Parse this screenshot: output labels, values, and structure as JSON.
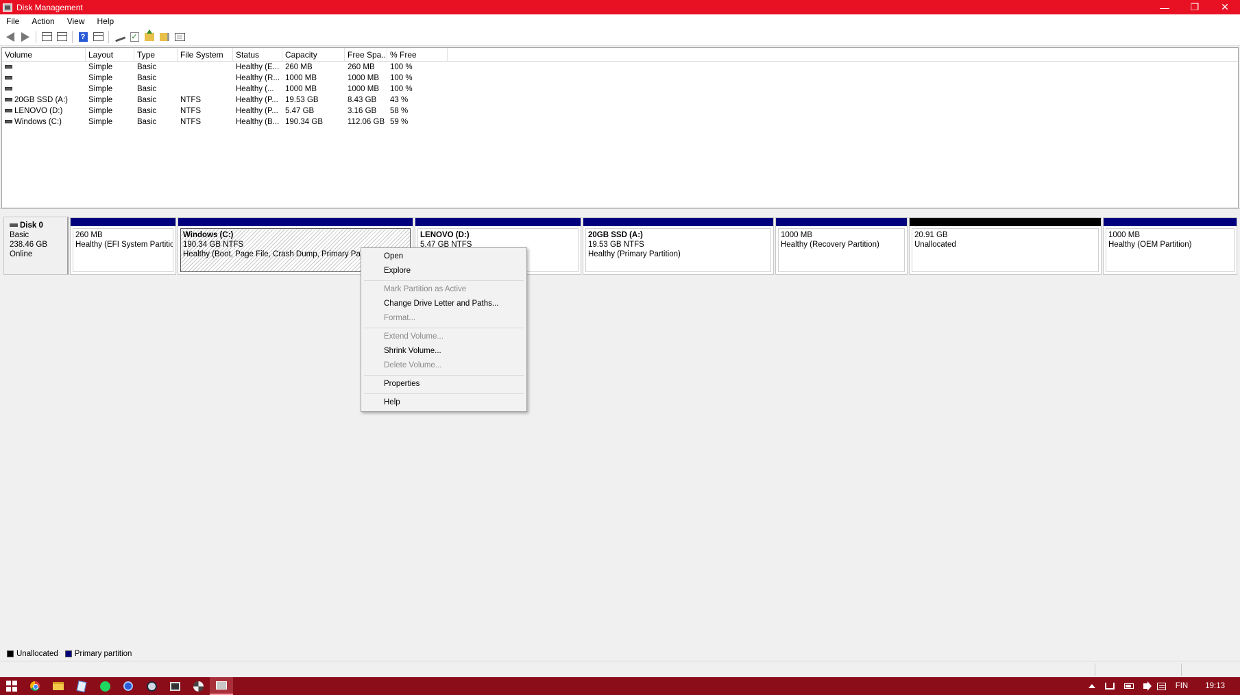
{
  "window": {
    "title": "Disk Management"
  },
  "menubar": [
    "File",
    "Action",
    "View",
    "Help"
  ],
  "columns": [
    "Volume",
    "Layout",
    "Type",
    "File System",
    "Status",
    "Capacity",
    "Free Spa...",
    "% Free"
  ],
  "volumes": [
    {
      "name": "",
      "layout": "Simple",
      "type": "Basic",
      "fs": "",
      "status": "Healthy (E...",
      "capacity": "260 MB",
      "free": "260 MB",
      "pct": "100 %"
    },
    {
      "name": "",
      "layout": "Simple",
      "type": "Basic",
      "fs": "",
      "status": "Healthy (R...",
      "capacity": "1000 MB",
      "free": "1000 MB",
      "pct": "100 %"
    },
    {
      "name": "",
      "layout": "Simple",
      "type": "Basic",
      "fs": "",
      "status": "Healthy (...",
      "capacity": "1000 MB",
      "free": "1000 MB",
      "pct": "100 %"
    },
    {
      "name": "20GB SSD (A:)",
      "layout": "Simple",
      "type": "Basic",
      "fs": "NTFS",
      "status": "Healthy (P...",
      "capacity": "19.53 GB",
      "free": "8.43 GB",
      "pct": "43 %"
    },
    {
      "name": "LENOVO (D:)",
      "layout": "Simple",
      "type": "Basic",
      "fs": "NTFS",
      "status": "Healthy (P...",
      "capacity": "5.47 GB",
      "free": "3.16 GB",
      "pct": "58 %"
    },
    {
      "name": "Windows (C:)",
      "layout": "Simple",
      "type": "Basic",
      "fs": "NTFS",
      "status": "Healthy (B...",
      "capacity": "190.34 GB",
      "free": "112.06 GB",
      "pct": "59 %"
    }
  ],
  "disk": {
    "name": "Disk 0",
    "type": "Basic",
    "size": "238.46 GB",
    "state": "Online"
  },
  "partitions": [
    {
      "name": "",
      "line1": "260 MB",
      "line2": "Healthy (EFI System Partition"
    },
    {
      "name": "Windows  (C:)",
      "line1": "190.34 GB NTFS",
      "line2": "Healthy (Boot, Page File, Crash Dump, Primary Partit"
    },
    {
      "name": "LENOVO  (D:)",
      "line1": "5.47 GB NTFS",
      "line2": ""
    },
    {
      "name": "20GB SSD  (A:)",
      "line1": "19.53 GB NTFS",
      "line2": "Healthy (Primary Partition)"
    },
    {
      "name": "",
      "line1": "1000 MB",
      "line2": "Healthy (Recovery Partition)"
    },
    {
      "name": "",
      "line1": "20.91 GB",
      "line2": "Unallocated"
    },
    {
      "name": "",
      "line1": "1000 MB",
      "line2": "Healthy (OEM Partition)"
    }
  ],
  "legend": {
    "unallocated": "Unallocated",
    "primary": "Primary partition",
    "unallocated_color": "#000000",
    "primary_color": "#00007e"
  },
  "context_menu": {
    "open": "Open",
    "explore": "Explore",
    "mark_active": "Mark Partition as Active",
    "change_letter": "Change Drive Letter and Paths...",
    "format": "Format...",
    "extend": "Extend Volume...",
    "shrink": "Shrink Volume...",
    "delete": "Delete Volume...",
    "properties": "Properties",
    "help": "Help"
  },
  "taskbar": {
    "language": "FIN",
    "time": "19:13"
  },
  "colors": {
    "titlebar": "#e81123",
    "taskbar": "#8b0d1a"
  }
}
